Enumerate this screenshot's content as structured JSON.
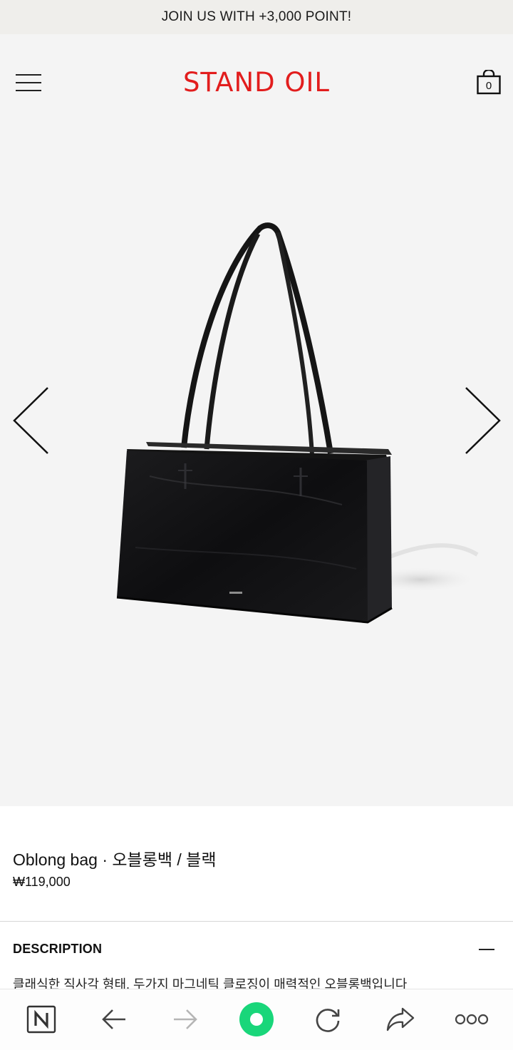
{
  "promo": {
    "text": "JOIN US WITH +3,000 POINT!"
  },
  "header": {
    "logo": "STAND OIL",
    "cart_count": "0",
    "menu_icon": "hamburger-menu-icon",
    "cart_icon": "shopping-bag-icon"
  },
  "gallery": {
    "prev_icon": "chevron-left-icon",
    "next_icon": "chevron-right-icon",
    "image": "black leather tote bag"
  },
  "product": {
    "name": "Oblong bag · 오블롱백 / 블랙",
    "price": "₩119,000"
  },
  "description": {
    "title": "DESCRIPTION",
    "text": "클래식한 직사각 형태, 두가지 마그네틱 클로징이 매력적인 오블롱백입니다",
    "toggle_icon": "minus-icon"
  },
  "browser_toolbar": {
    "items": [
      "naver-home-icon",
      "back-arrow-icon",
      "forward-arrow-icon",
      "green-dot-icon",
      "refresh-icon",
      "share-icon",
      "more-icon"
    ]
  },
  "colors": {
    "brand": "#e21d1d",
    "promo_bg": "#efeeeb",
    "gallery_bg": "#f4f4f4",
    "accent_green": "#19d67a"
  }
}
